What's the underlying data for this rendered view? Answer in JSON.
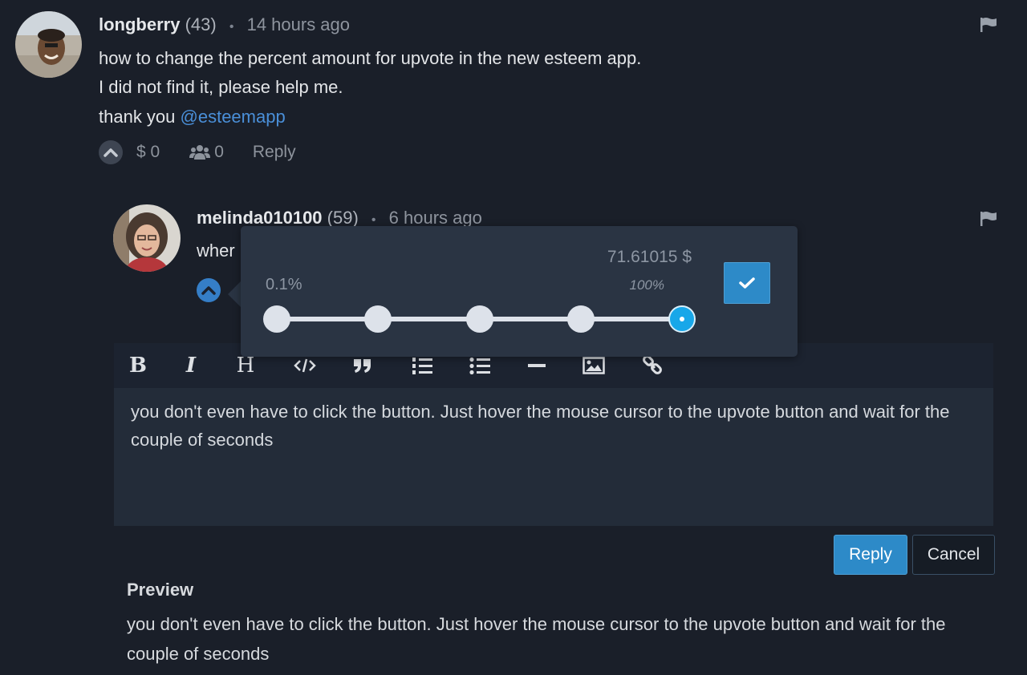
{
  "comment1": {
    "author": "longberry",
    "reputation": "(43)",
    "separator": "•",
    "time": "14 hours ago",
    "body_lines": [
      "how to change the percent amount for upvote in the new esteem app.",
      "I did not find it, please help me.",
      "thank you "
    ],
    "mention": "@esteemapp",
    "payout": "$ 0",
    "voters": "0",
    "reply_label": "Reply"
  },
  "comment2": {
    "author": "melinda010100",
    "reputation": "(59)",
    "separator": "•",
    "time": "6 hours ago",
    "body_partial": "wher"
  },
  "vote_popup": {
    "amount": "71.61015 $",
    "min_percent": "0.1%",
    "current_percent": "100%",
    "slider_value_percent": 100,
    "steps": 5
  },
  "editor": {
    "toolbar": [
      {
        "name": "bold",
        "label": "B"
      },
      {
        "name": "italic",
        "label": "I"
      },
      {
        "name": "heading",
        "label": "H"
      },
      {
        "name": "code",
        "label": ""
      },
      {
        "name": "quote",
        "label": ""
      },
      {
        "name": "ordered-list",
        "label": ""
      },
      {
        "name": "unordered-list",
        "label": ""
      },
      {
        "name": "horizontal-rule",
        "label": ""
      },
      {
        "name": "image",
        "label": ""
      },
      {
        "name": "link",
        "label": ""
      }
    ],
    "text": "you don't even have to click the button. Just hover the mouse cursor to the upvote button and wait for the couple of seconds"
  },
  "buttons": {
    "reply": "Reply",
    "cancel": "Cancel"
  },
  "preview": {
    "title": "Preview",
    "text": "you don't even have to click the button. Just hover the mouse cursor to the upvote button and wait for the couple of seconds"
  },
  "colors": {
    "background": "#1a1f29",
    "accent": "#2d8ac8",
    "slider_active": "#18a7e9",
    "mention": "#4a8fd8"
  }
}
